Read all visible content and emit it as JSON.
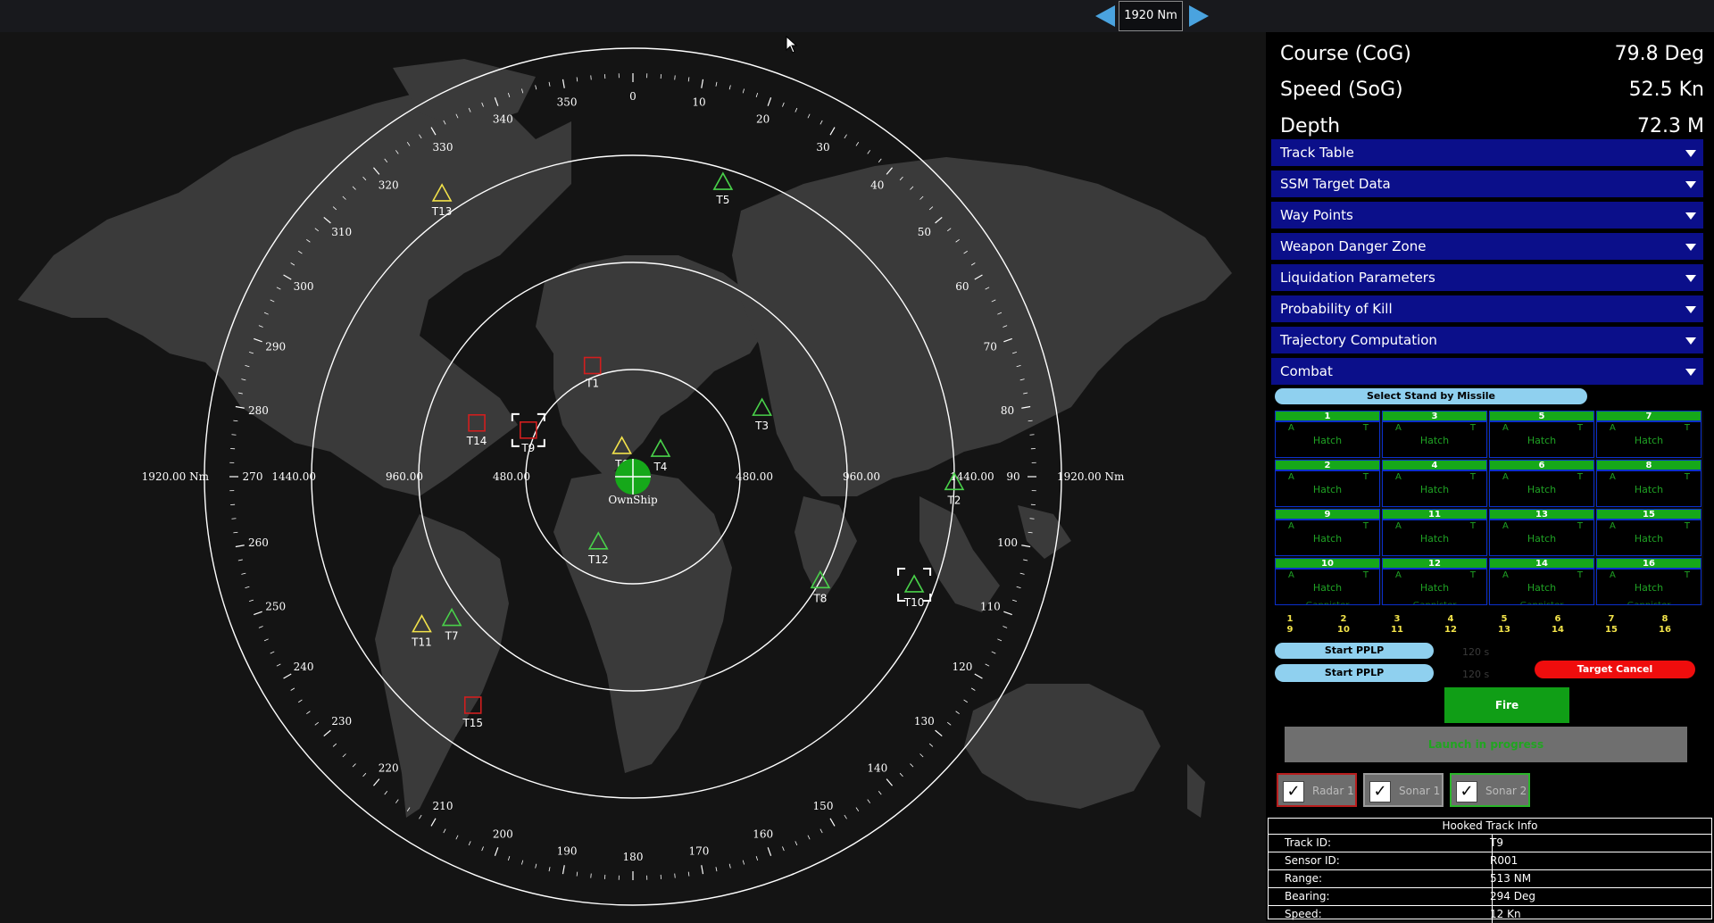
{
  "range": {
    "label": "1920 Nm"
  },
  "nav": [
    {
      "label": "Course (CoG)",
      "value": "79.8 Deg"
    },
    {
      "label": "Speed (SoG)",
      "value": "52.5 Kn"
    },
    {
      "label": "Depth",
      "value": "72.3 M"
    }
  ],
  "accordion": [
    "Track Table",
    "SSM Target Data",
    "Way Points",
    "Weapon Danger Zone",
    "Liquidation Parameters",
    "Probability of Kill",
    "Trajectory Computation",
    "Combat"
  ],
  "combat": {
    "select_standby": "Select Stand by Missile",
    "cells": [
      {
        "n": "1",
        "a": "A",
        "t": "T",
        "status": "Hatch"
      },
      {
        "n": "3",
        "a": "A",
        "t": "T",
        "status": "Hatch"
      },
      {
        "n": "5",
        "a": "A",
        "t": "T",
        "status": "Hatch"
      },
      {
        "n": "7",
        "a": "A",
        "t": "T",
        "status": "Hatch"
      },
      {
        "n": "2",
        "a": "A",
        "t": "T",
        "status": "Hatch"
      },
      {
        "n": "4",
        "a": "A",
        "t": "T",
        "status": "Hatch"
      },
      {
        "n": "6",
        "a": "A",
        "t": "T",
        "status": "Hatch"
      },
      {
        "n": "8",
        "a": "A",
        "t": "T",
        "status": "Hatch"
      },
      {
        "n": "9",
        "a": "A",
        "t": "T",
        "status": "Hatch"
      },
      {
        "n": "11",
        "a": "A",
        "t": "T",
        "status": "Hatch"
      },
      {
        "n": "13",
        "a": "A",
        "t": "T",
        "status": "Hatch"
      },
      {
        "n": "15",
        "a": "A",
        "t": "T",
        "status": "Hatch"
      },
      {
        "n": "10",
        "a": "A",
        "t": "T",
        "status": "Hatch",
        "cap": "Gannister"
      },
      {
        "n": "12",
        "a": "A",
        "t": "T",
        "status": "Hatch",
        "cap": "Gannister"
      },
      {
        "n": "14",
        "a": "A",
        "t": "T",
        "status": "Hatch",
        "cap": "Gannister"
      },
      {
        "n": "16",
        "a": "A",
        "t": "T",
        "status": "Hatch",
        "cap": "Gannister"
      }
    ],
    "index_pairs": [
      [
        "1",
        "9"
      ],
      [
        "2",
        "10"
      ],
      [
        "3",
        "11"
      ],
      [
        "4",
        "12"
      ],
      [
        "5",
        "13"
      ],
      [
        "6",
        "14"
      ],
      [
        "7",
        "15"
      ],
      [
        "8",
        "16"
      ]
    ],
    "pplp": [
      {
        "label": "Start PPLP",
        "timer": "120 s"
      },
      {
        "label": "Start PPLP",
        "timer": "120 s"
      }
    ],
    "target_cancel": "Target Cancel",
    "fire": "Fire",
    "launch_status": "Launch in progress"
  },
  "sensors": [
    {
      "label": "Radar 1",
      "color": "#b81e1e"
    },
    {
      "label": "Sonar 1",
      "color": "#9a9a9a"
    },
    {
      "label": "Sonar 2",
      "color": "#2bb52b"
    }
  ],
  "hooked": {
    "title": "Hooked Track Info",
    "rows": [
      {
        "k": "Track ID:",
        "v": "T9"
      },
      {
        "k": "Sensor ID:",
        "v": "R001"
      },
      {
        "k": "Range:",
        "v": "513 NM"
      },
      {
        "k": "Bearing:",
        "v": "294 Deg"
      },
      {
        "k": "Speed:",
        "v": "12 Kn"
      }
    ]
  },
  "radar": {
    "ownship_label": "OwnShip",
    "range_labels": [
      {
        "text": "480.00",
        "side": "left",
        "ring": 1
      },
      {
        "text": "960.00",
        "side": "left",
        "ring": 2
      },
      {
        "text": "1440.00",
        "side": "left",
        "ring": 3
      },
      {
        "text": "1920.00 Nm",
        "side": "left",
        "ring": 4
      },
      {
        "text": "480.00",
        "side": "right",
        "ring": 1
      },
      {
        "text": "960.00",
        "side": "right",
        "ring": 2
      },
      {
        "text": "1440.00",
        "side": "right",
        "ring": 3
      },
      {
        "text": "1920.00 Nm",
        "side": "right",
        "ring": 4
      }
    ],
    "tracks": [
      {
        "id": "T1",
        "shape": "square",
        "color": "#d21e1e",
        "bearing": 340,
        "range": 530
      },
      {
        "id": "T3",
        "shape": "triangle",
        "color": "#49d14a",
        "bearing": 62,
        "range": 655
      },
      {
        "id": "T4",
        "shape": "triangle",
        "color": "#49d14a",
        "bearing": 45,
        "range": 175
      },
      {
        "id": "T5",
        "shape": "triangle",
        "color": "#49d14a",
        "bearing": 17,
        "range": 1380
      },
      {
        "id": "T6",
        "shape": "triangle",
        "color": "#f2e24a",
        "bearing": 340,
        "range": 145
      },
      {
        "id": "T7",
        "shape": "triangle",
        "color": "#49d14a",
        "bearing": 232,
        "range": 1030
      },
      {
        "id": "T8",
        "shape": "triangle",
        "color": "#49d14a",
        "bearing": 119,
        "range": 960
      },
      {
        "id": "T9",
        "shape": "square",
        "color": "#d21e1e",
        "bearing": 294,
        "range": 513,
        "hooked": true
      },
      {
        "id": "T10",
        "shape": "triangle",
        "color": "#49d14a",
        "bearing": 111,
        "range": 1350,
        "hooked": true
      },
      {
        "id": "T11",
        "shape": "triangle",
        "color": "#f2e24a",
        "bearing": 235,
        "range": 1155
      },
      {
        "id": "T12",
        "shape": "triangle",
        "color": "#49d14a",
        "bearing": 208,
        "range": 330
      },
      {
        "id": "T13",
        "shape": "triangle",
        "color": "#f2e24a",
        "bearing": 326,
        "range": 1530
      },
      {
        "id": "T14",
        "shape": "square",
        "color": "#d21e1e",
        "bearing": 289,
        "range": 740
      },
      {
        "id": "T15",
        "shape": "square",
        "color": "#d21e1e",
        "bearing": 215,
        "range": 1250
      },
      {
        "id": "T2",
        "shape": "triangle",
        "color": "#49d14a",
        "bearing": 91,
        "range": 1440
      }
    ]
  }
}
